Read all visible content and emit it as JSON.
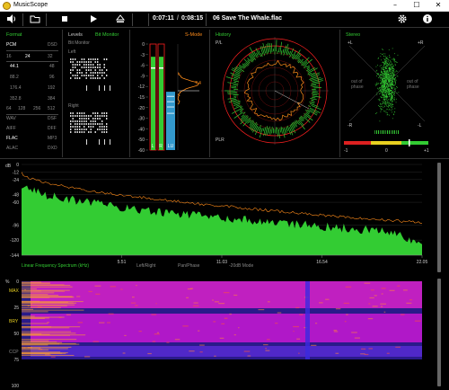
{
  "window": {
    "title": "MusicScope",
    "minimize": "–",
    "maximize": "☐",
    "close": "✕"
  },
  "toolbar": {
    "position": "0:07:11",
    "duration": "0:08:15",
    "track": "06 Save The Whale.flac",
    "icons": [
      "volume-icon",
      "folder-icon",
      "stop-icon",
      "play-icon",
      "eject-icon",
      "settings-icon",
      "info-icon"
    ]
  },
  "format": {
    "title": "Format",
    "rows": [
      [
        "PCM",
        "",
        "DSD"
      ],
      [
        "16",
        "24",
        "32"
      ],
      [
        "44.1",
        "",
        "48"
      ],
      [
        "88.2",
        "",
        "96"
      ],
      [
        "176.4",
        "",
        "192"
      ],
      [
        "352.8",
        "",
        "384"
      ],
      [
        "64",
        "128",
        "256",
        "512"
      ]
    ],
    "containers": [
      [
        "WAV",
        "DSF"
      ],
      [
        "AIFF",
        "DFF"
      ],
      [
        "FLAC",
        "MP3"
      ],
      [
        "ALAC",
        "DXD"
      ]
    ]
  },
  "levels": {
    "title": "Levels",
    "mode": "Bit Monitor",
    "subtitle": "Bit Monitor",
    "left": "Left",
    "right": "Right",
    "scale": [
      "0",
      "-3",
      "-6",
      "-9",
      "-12",
      "-15",
      "-20",
      "-30",
      "-40",
      "-50",
      "-60"
    ],
    "peak_value": "7.4",
    "s_mode": "S-Mode",
    "channel_labels": [
      "L",
      "R",
      "LU"
    ],
    "left_peak": 0.88,
    "right_peak": 0.88,
    "left_rms": 0.78,
    "loudness": 0.55
  },
  "history": {
    "title": "History",
    "labels": [
      "P/L",
      "PLR"
    ]
  },
  "stereo": {
    "title": "Stereo",
    "labels": [
      "+L",
      "+R",
      "-R",
      "-L"
    ],
    "out_of_phase": "out of phase",
    "corr_labels": [
      "-1",
      "0",
      "+1"
    ]
  },
  "spectrum": {
    "db_labels": [
      "dB",
      "0",
      "-12",
      "-24",
      "-36",
      "-48",
      "-60",
      "-72",
      "-84",
      "-96",
      "-108",
      "-120",
      "-132",
      "-144"
    ],
    "freq_labels": [
      "5.51",
      "11.03",
      "16.54",
      "22.05"
    ],
    "info_left": "Linear Frequency Spectrum (kHz)",
    "info_mid": [
      "Left/Right",
      "Pan/Phase",
      "-20dB Mode"
    ]
  },
  "spectrogram": {
    "pct_labels": [
      "%",
      "0",
      "25",
      "50",
      "75",
      "100"
    ],
    "band_labels": [
      "MAX",
      "BRY",
      "CCP"
    ]
  },
  "colors": {
    "accent": "#33cc33",
    "orange": "#ff8c1a",
    "red": "#ff2020",
    "blue": "#3399cc"
  }
}
